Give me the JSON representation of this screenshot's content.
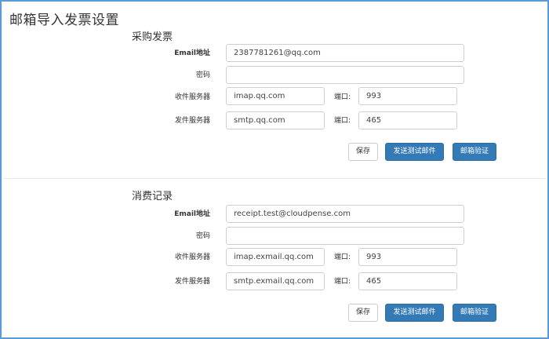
{
  "page": {
    "title": "邮箱导入发票设置"
  },
  "sections": [
    {
      "title": "采购发票",
      "email_label": "Email地址",
      "email_value": "2387781261@qq.com",
      "password_label": "密码",
      "password_value": "",
      "incoming_label": "收件服务器",
      "incoming_value": "imap.qq.com",
      "incoming_port_label": "端口:",
      "incoming_port_value": "993",
      "outgoing_label": "发件服务器",
      "outgoing_value": "smtp.qq.com",
      "outgoing_port_label": "端口:",
      "outgoing_port_value": "465",
      "save_label": "保存",
      "test_label": "发送测试邮件",
      "verify_label": "邮箱验证"
    },
    {
      "title": "消费记录",
      "email_label": "Email地址",
      "email_value": "receipt.test@cloudpense.com",
      "password_label": "密码",
      "password_value": "",
      "incoming_label": "收件服务器",
      "incoming_value": "imap.exmail.qq.com",
      "incoming_port_label": "端口:",
      "incoming_port_value": "993",
      "outgoing_label": "发件服务器",
      "outgoing_value": "smtp.exmail.qq.com",
      "outgoing_port_label": "端口:",
      "outgoing_port_value": "465",
      "save_label": "保存",
      "test_label": "发送测试邮件",
      "verify_label": "邮箱验证"
    }
  ],
  "colors": {
    "frame_border": "#5b9bd5",
    "primary_button": "#337ab7"
  }
}
